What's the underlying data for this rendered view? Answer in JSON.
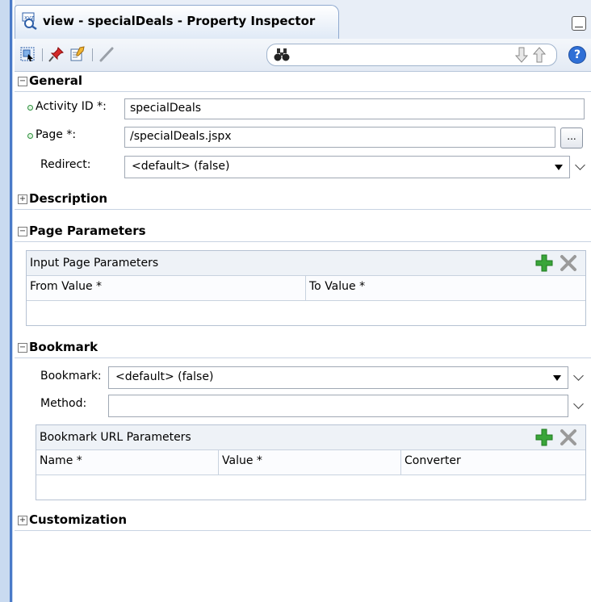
{
  "window": {
    "title": "view - specialDeals - Property Inspector"
  },
  "toolbar": {
    "icons": [
      "select-icon",
      "pin-icon",
      "edit-icon",
      "pencil-icon",
      "binoculars-icon",
      "arrow-down-icon",
      "arrow-up-icon",
      "help-icon"
    ],
    "help_glyph": "?"
  },
  "sections": {
    "general": "General",
    "description": "Description",
    "page_parameters": "Page Parameters",
    "bookmark": "Bookmark",
    "customization": "Customization"
  },
  "general": {
    "activity_id_label": "Activity ID *:",
    "activity_id_value": "specialDeals",
    "page_label": "Page *:",
    "page_value": "/specialDeals.jspx",
    "browse_label": "...",
    "redirect_label": "Redirect:",
    "redirect_value": "<default> (false)"
  },
  "page_params_table": {
    "title": "Input Page Parameters",
    "columns": [
      "From Value *",
      "To Value *"
    ]
  },
  "bookmark": {
    "bookmark_label": "Bookmark:",
    "bookmark_value": "<default> (false)",
    "method_label": "Method:",
    "method_value": ""
  },
  "bookmark_table": {
    "title": "Bookmark URL Parameters",
    "columns": [
      "Name *",
      "Value *",
      "Converter"
    ]
  },
  "colors": {
    "accent": "#4a7ac8",
    "add": "#3aa53a",
    "required_dot": "#2f8f3f"
  }
}
